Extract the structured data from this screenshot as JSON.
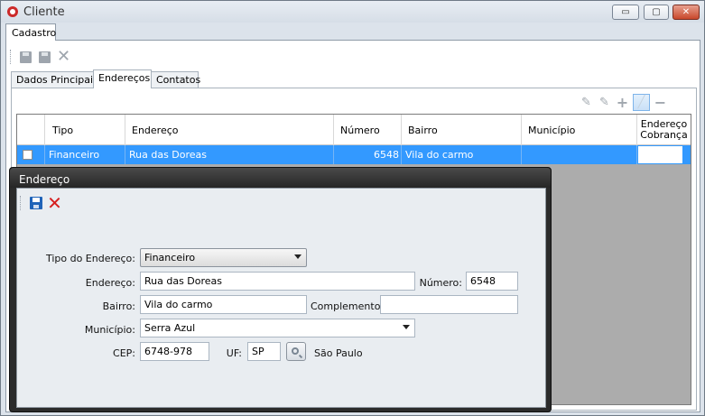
{
  "window": {
    "title": "Cliente",
    "buttons": {
      "minimize": "▭",
      "maximize": "▢",
      "close": "✕"
    }
  },
  "doc_tab": "Cadastro",
  "tabs": [
    {
      "label": "Dados Principais"
    },
    {
      "label": "Endereços",
      "active": true
    },
    {
      "label": "Contatos"
    }
  ],
  "grid": {
    "columns": [
      "Tipo",
      "Endereço",
      "Número",
      "Bairro",
      "Município",
      "Endereço Cobrança"
    ],
    "rows": [
      {
        "tipo": "Financeiro",
        "endereco": "Rua das Doreas",
        "numero": "6548",
        "bairro": "Vila do carmo",
        "municipio": "",
        "cobranca": ""
      }
    ],
    "selected_row_color": "#3399ff"
  },
  "dialog": {
    "title": "Endereço",
    "labels": {
      "tipo": "Tipo do Endereço:",
      "endereco": "Endereço:",
      "numero": "Número:",
      "bairro": "Bairro:",
      "complemento": "Complemento:",
      "municipio": "Município:",
      "cep": "CEP:",
      "uf": "UF:"
    },
    "values": {
      "tipo": "Financeiro",
      "endereco": "Rua das Doreas",
      "numero": "6548",
      "bairro": "Vila do carmo",
      "complemento": "",
      "municipio": "Serra Azul",
      "cep": "6748-978",
      "uf": "SP",
      "estado": "São Paulo"
    }
  },
  "icons": {
    "toolbar_main": [
      "save-icon",
      "save-copy-icon",
      "delete-icon"
    ],
    "toolbar_grid": [
      "edit-icon",
      "edit-alt-icon",
      "add-icon",
      "pencil-active-icon",
      "remove-icon"
    ],
    "dialog_toolbar": [
      "save-icon",
      "cancel-icon"
    ]
  }
}
